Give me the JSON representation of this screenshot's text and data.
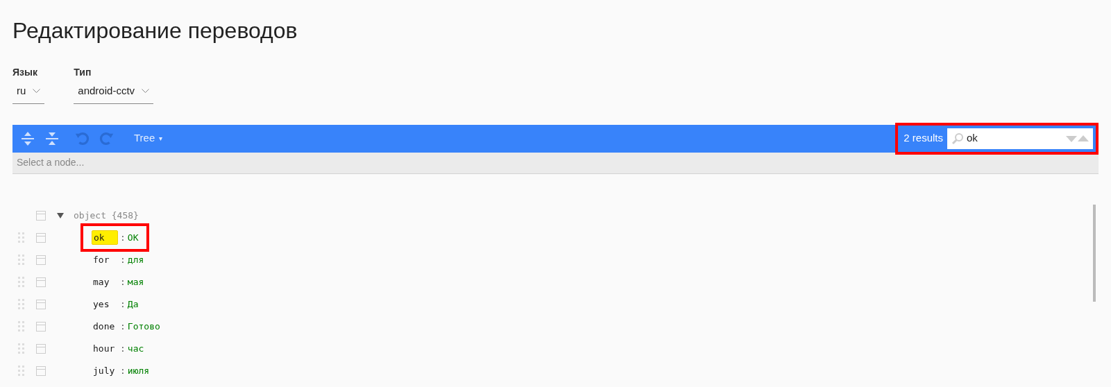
{
  "title": "Редактирование переводов",
  "selects": [
    {
      "label": "Язык",
      "value": "ru"
    },
    {
      "label": "Тип",
      "value": "android-cctv"
    }
  ],
  "toolbar": {
    "mode": "Tree",
    "mode_caret": "▾",
    "search": {
      "results": "2 results",
      "value": "ok",
      "annotated": true
    }
  },
  "status_bar": {
    "text": "Select a node..."
  },
  "tree": {
    "type": "object",
    "count": "{458}",
    "expanded": true,
    "children": [
      {
        "key": "ok",
        "separator": ":",
        "value": "OK",
        "match": true,
        "annotated": true
      },
      {
        "key": "for",
        "separator": ":",
        "value": "для",
        "match": false,
        "annotated": false
      },
      {
        "key": "may",
        "separator": ":",
        "value": "мая",
        "match": false,
        "annotated": false
      },
      {
        "key": "yes",
        "separator": ":",
        "value": "Да",
        "match": false,
        "annotated": false
      },
      {
        "key": "done",
        "separator": ":",
        "value": "Готово",
        "match": false,
        "annotated": false
      },
      {
        "key": "hour",
        "separator": ":",
        "value": "час",
        "match": false,
        "annotated": false
      },
      {
        "key": "july",
        "separator": ":",
        "value": "июля",
        "match": false,
        "annotated": false
      }
    ]
  }
}
